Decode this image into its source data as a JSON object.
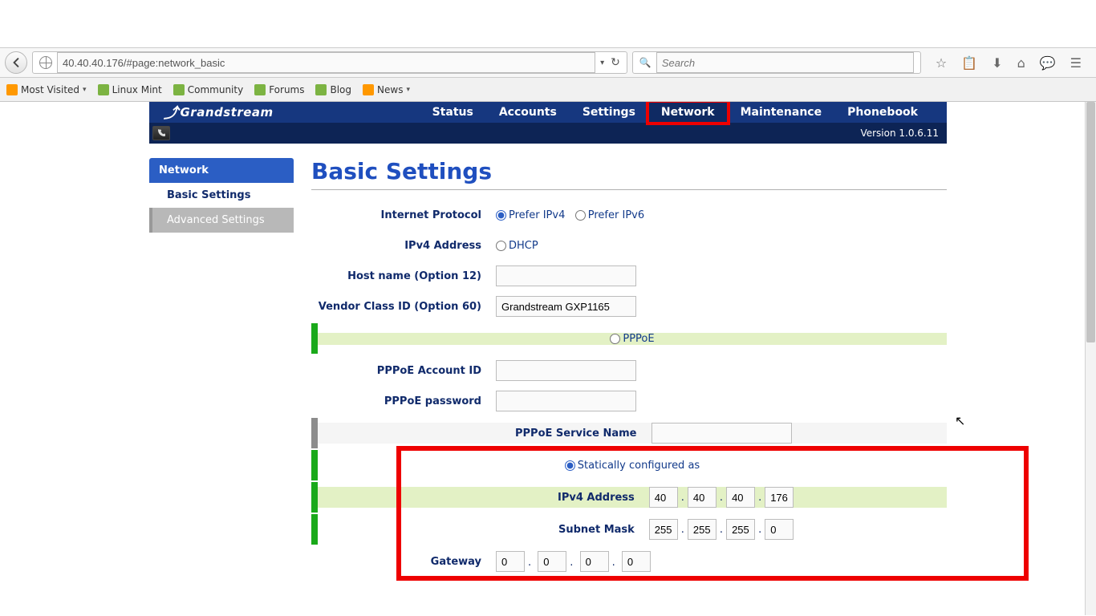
{
  "browser": {
    "url": "40.40.40.176/#page:network_basic",
    "search_placeholder": "Search",
    "bookmarks": [
      {
        "label": "Most Visited",
        "icon": "fav",
        "dropdown": true
      },
      {
        "label": "Linux Mint",
        "icon": "mint"
      },
      {
        "label": "Community",
        "icon": "mint"
      },
      {
        "label": "Forums",
        "icon": "mint"
      },
      {
        "label": "Blog",
        "icon": "mint"
      },
      {
        "label": "News",
        "icon": "rss",
        "dropdown": true
      }
    ],
    "toolbar_icons": {
      "star": "☆",
      "clipboard": "📋",
      "download": "⬇",
      "home": "⌂",
      "chat": "💬",
      "menu": "☰"
    }
  },
  "app": {
    "logo": "Grandstream",
    "menu": [
      {
        "key": "status",
        "label": "Status"
      },
      {
        "key": "accounts",
        "label": "Accounts"
      },
      {
        "key": "settings",
        "label": "Settings"
      },
      {
        "key": "network",
        "label": "Network",
        "active": true
      },
      {
        "key": "maintenance",
        "label": "Maintenance"
      },
      {
        "key": "phonebook",
        "label": "Phonebook"
      }
    ],
    "version": "Version 1.0.6.11"
  },
  "sidebar": {
    "head": "Network",
    "items": [
      {
        "label": "Basic Settings",
        "kind": "plain"
      },
      {
        "label": "Advanced Settings",
        "kind": "adv"
      }
    ]
  },
  "page": {
    "title": "Basic Settings",
    "labels": {
      "internet_protocol": "Internet Protocol",
      "ipv4_address": "IPv4 Address",
      "host_name": "Host name (Option 12)",
      "vendor_class": "Vendor Class ID (Option 60)",
      "pppoe_account": "PPPoE Account ID",
      "pppoe_password": "PPPoE password",
      "pppoe_service": "PPPoE Service Name",
      "subnet_mask": "Subnet Mask",
      "gateway": "Gateway"
    },
    "radios": {
      "prefer_ipv4": "Prefer IPv4",
      "prefer_ipv6": "Prefer IPv6",
      "dhcp": "DHCP",
      "pppoe": "PPPoE",
      "static": "Statically configured as"
    },
    "values": {
      "host_name": "",
      "vendor_class": "Grandstream GXP1165",
      "pppoe_account": "",
      "pppoe_password": "",
      "pppoe_service": "",
      "ipv4": [
        "40",
        "40",
        "40",
        "176"
      ],
      "subnet": [
        "255",
        "255",
        "255",
        "0"
      ],
      "gateway": [
        "0",
        "0",
        "0",
        "0"
      ]
    }
  }
}
